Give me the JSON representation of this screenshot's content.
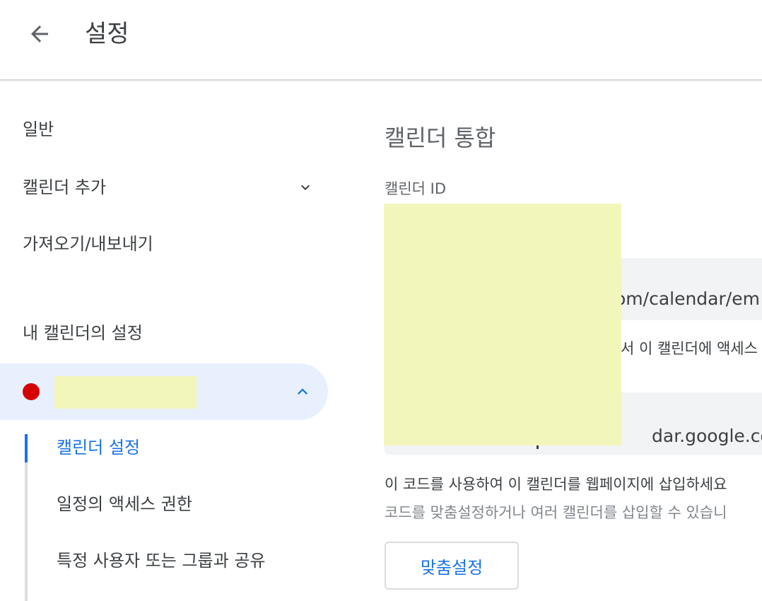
{
  "header": {
    "title": "설정"
  },
  "sidebar": {
    "items": [
      {
        "label": "일반"
      },
      {
        "label": "캘린더 추가"
      },
      {
        "label": "가져오기/내보내기"
      }
    ],
    "section_label": "내 캘린더의 설정",
    "calendar": {
      "color": "#d50000",
      "name": ""
    },
    "subitems": [
      {
        "label": "캘린더 설정",
        "active": true
      },
      {
        "label": "일정의 액세스 권한"
      },
      {
        "label": "특정 사용자 또는 그룹과 공유"
      }
    ]
  },
  "main": {
    "section_heading": "캘린더 통합",
    "calendar_id_label": "캘린더 ID",
    "public_url_partial": "om/calendar/em",
    "public_url_helper_partial": "서 이 캘린더에 액세스",
    "embed_code_partial": "dar.google.com/",
    "embed_helper": "이 코드를 사용하여 이 캘린더를 웹페이지에 삽입하세요",
    "embed_helper_2": "코드를 맞춤설정하거나 여러 캘린더를 삽입할 수 있습니",
    "customize_button": "맞춤설정"
  },
  "colors": {
    "accent": "#1a73e8",
    "selected_bg": "#e8f0fe",
    "redaction": "#f3f6bb"
  }
}
